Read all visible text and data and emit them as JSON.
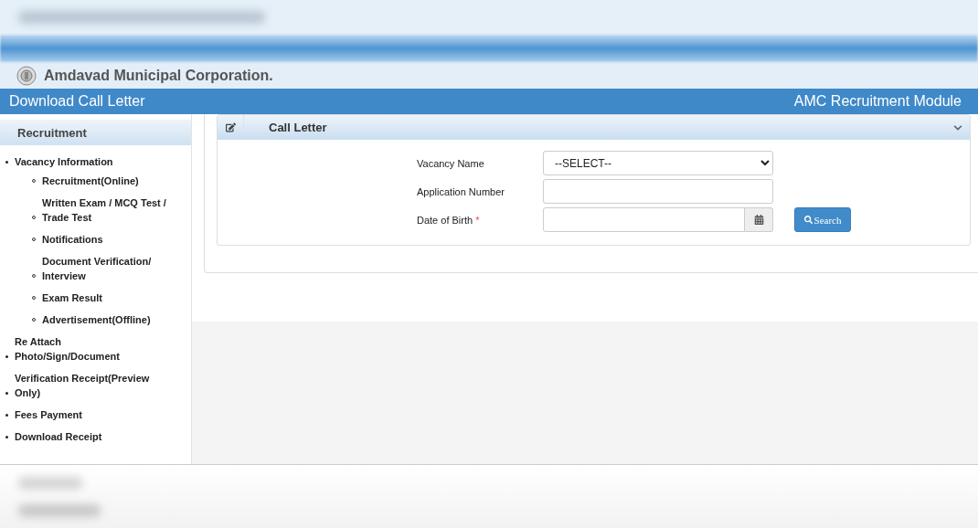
{
  "header": {
    "organization": "Amdavad Municipal Corporation.",
    "page_title": "Download Call Letter",
    "module": "AMC Recruitment Module"
  },
  "sidebar": {
    "title": "Recruitment",
    "items": [
      {
        "label": "Vacancy Information",
        "children": [
          {
            "label": "Recruitment(Online)"
          },
          {
            "label": "Written Exam / MCQ Test / Trade Test"
          },
          {
            "label": "Notifications"
          },
          {
            "label": "Document Verification/ Interview"
          },
          {
            "label": "Exam Result"
          },
          {
            "label": "Advertisement(Offline)"
          }
        ]
      },
      {
        "label": "Re Attach Photo/Sign/Document"
      },
      {
        "label": "Verification Receipt(Preview Only)"
      },
      {
        "label": "Fees Payment"
      },
      {
        "label": "Download Receipt"
      }
    ]
  },
  "panel": {
    "title": "Call Letter",
    "expanded": true,
    "fields": [
      {
        "kind": "select",
        "label": "Vacancy Name",
        "value": "--SELECT--"
      },
      {
        "kind": "text",
        "label": "Application Number"
      },
      {
        "kind": "date",
        "label": "Date of Birth",
        "required": true,
        "required_mark": "*"
      }
    ],
    "search_button": "Search"
  }
}
